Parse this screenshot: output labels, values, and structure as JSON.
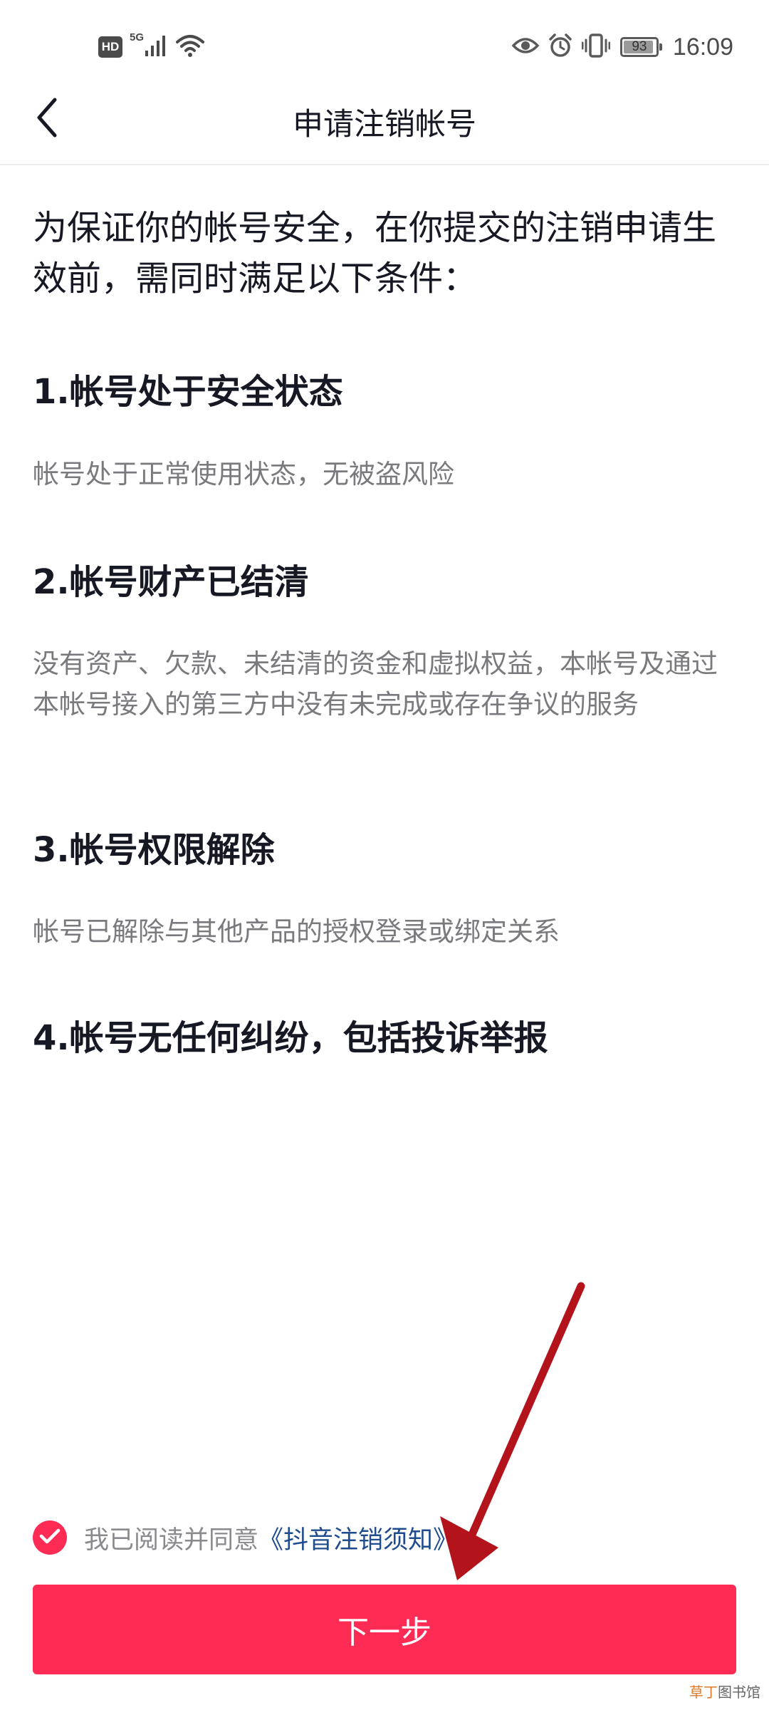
{
  "status_bar": {
    "hd_label": "HD",
    "network_label": "5G",
    "battery_level": 93,
    "battery_text": "93",
    "time": "16:09",
    "icons": [
      "hd-icon",
      "signal-icon",
      "wifi-icon",
      "eye-icon",
      "alarm-icon",
      "vibrate-icon",
      "battery-icon"
    ]
  },
  "nav": {
    "title": "申请注销帐号",
    "back_icon": "chevron-left-icon"
  },
  "intro": "为保证你的帐号安全，在你提交的注销申请生效前，需同时满足以下条件：",
  "conditions": [
    {
      "title": "1.帐号处于安全状态",
      "desc": "帐号处于正常使用状态，无被盗风险"
    },
    {
      "title": "2.帐号财产已结清",
      "desc": "没有资产、欠款、未结清的资金和虚拟权益，本帐号及通过本帐号接入的第三方中没有未完成或存在争议的服务"
    },
    {
      "title": "3.帐号权限解除",
      "desc": "帐号已解除与其他产品的授权登录或绑定关系"
    },
    {
      "title": "4.帐号无任何纠纷，包括投诉举报",
      "desc": ""
    }
  ],
  "agreement": {
    "checked": true,
    "text": "我已阅读并同意",
    "link": "《抖音注销须知》"
  },
  "next_button": {
    "label": "下一步"
  },
  "colors": {
    "accent": "#fe2c55",
    "link": "#1f4b8f",
    "annotation": "#b3141c"
  },
  "watermark": {
    "accent": "草丁",
    "text": "图书馆"
  }
}
